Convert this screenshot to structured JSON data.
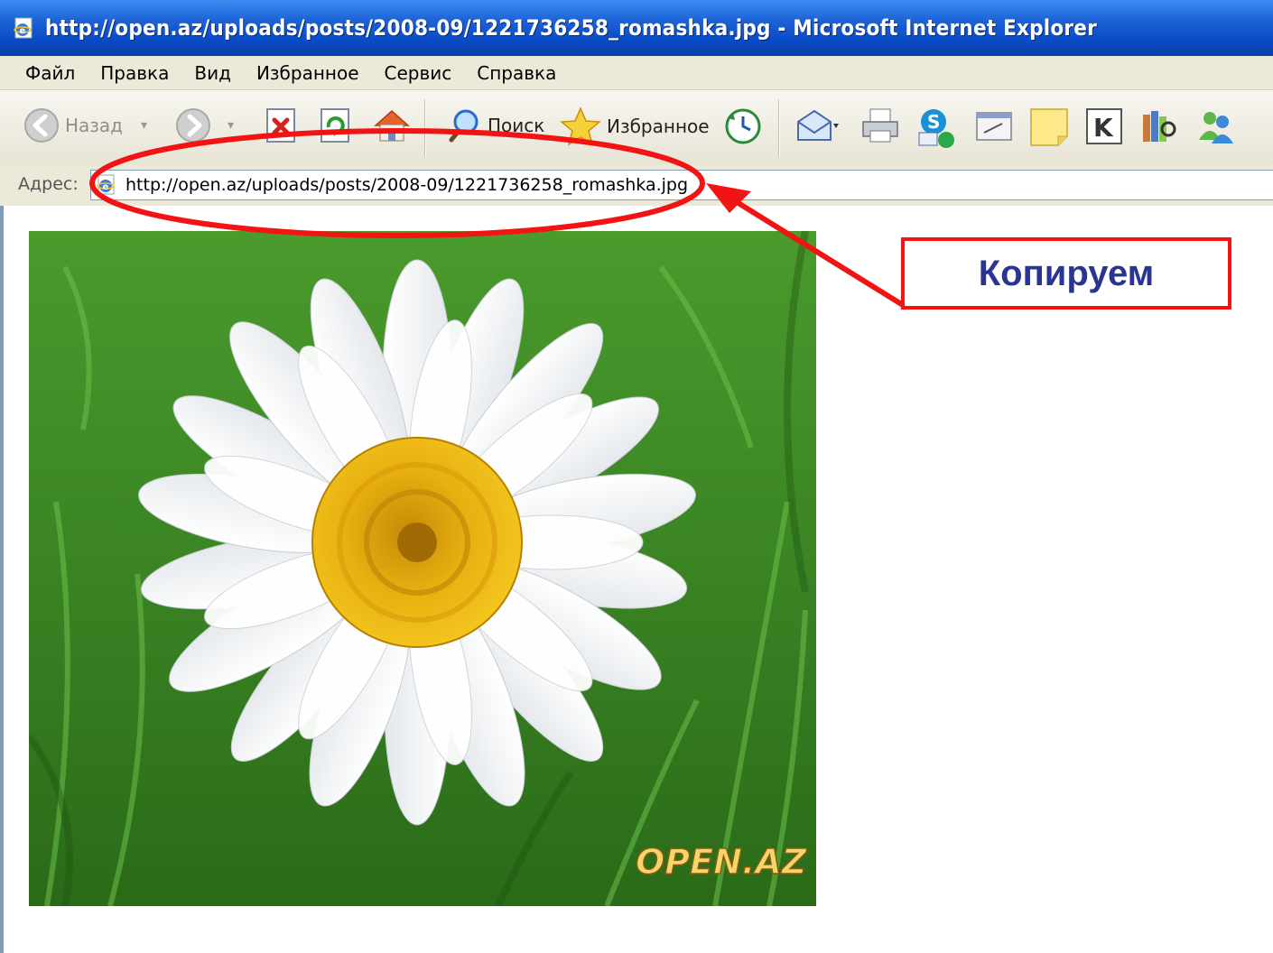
{
  "window": {
    "title": "http://open.az/uploads/posts/2008-09/1221736258_romashka.jpg - Microsoft Internet Explorer",
    "icon": "ie-page-icon"
  },
  "menu": {
    "items": [
      "Файл",
      "Правка",
      "Вид",
      "Избранное",
      "Сервис",
      "Справка"
    ]
  },
  "toolbar": {
    "back_label": "Назад",
    "search_label": "Поиск",
    "favorites_label": "Избранное"
  },
  "address": {
    "label": "Адрес:",
    "url": "http://open.az/uploads/posts/2008-09/1221736258_romashka.jpg"
  },
  "page": {
    "image_subject": "white daisy flower on green grass",
    "watermark": "OPEN.AZ"
  },
  "annotation": {
    "callout_text": "Копируем",
    "color": "#f21414",
    "text_color": "#283593"
  }
}
